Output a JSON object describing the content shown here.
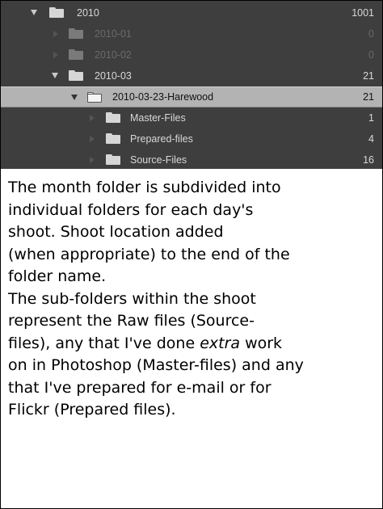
{
  "folder_tree": {
    "rows": [
      {
        "label": "2010",
        "count": "1001",
        "icon": "folder-icon",
        "expand": "triangle-down-icon"
      },
      {
        "label": "2010-01",
        "count": "0",
        "icon": "folder-icon",
        "expand": "triangle-right-icon"
      },
      {
        "label": "2010-02",
        "count": "0",
        "icon": "folder-icon",
        "expand": "triangle-right-icon"
      },
      {
        "label": "2010-03",
        "count": "21",
        "icon": "folder-icon",
        "expand": "triangle-down-icon"
      },
      {
        "label": "2010-03-23-Harewood",
        "count": "21",
        "icon": "folder-open-icon",
        "expand": "triangle-down-icon",
        "selected": true
      },
      {
        "label": "Master-Files",
        "count": "1",
        "icon": "folder-icon",
        "expand": "triangle-right-icon"
      },
      {
        "label": "Prepared-files",
        "count": "4",
        "icon": "folder-icon",
        "expand": "triangle-right-icon"
      },
      {
        "label": "Source-Files",
        "count": "16",
        "icon": "folder-icon",
        "expand": "triangle-right-icon"
      }
    ]
  },
  "caption": {
    "l1": "The month folder is subdivided into",
    "l2": "individual folders for each day's",
    "l3": "shoot.  Shoot location added",
    "l4": "(when appropriate) to the end of the",
    "l5": "folder name.",
    "l6": "The sub-folders within the shoot",
    "l7": "represent the Raw files (Source-",
    "l8a": "files), any that I've done ",
    "l8b": "extra",
    "l8c": " work",
    "l9": "on in Photoshop (Master-files) and any",
    "l10": "that I've prepared for e-mail or for",
    "l11": "Flickr (Prepared files)."
  },
  "colors": {
    "panel_bg": "#3e3e3e",
    "selected_row_bg": "#b3b3b3",
    "text_light": "#d8d8d8",
    "text_dim": "#6a6a6a",
    "caption_text": "#000000"
  }
}
